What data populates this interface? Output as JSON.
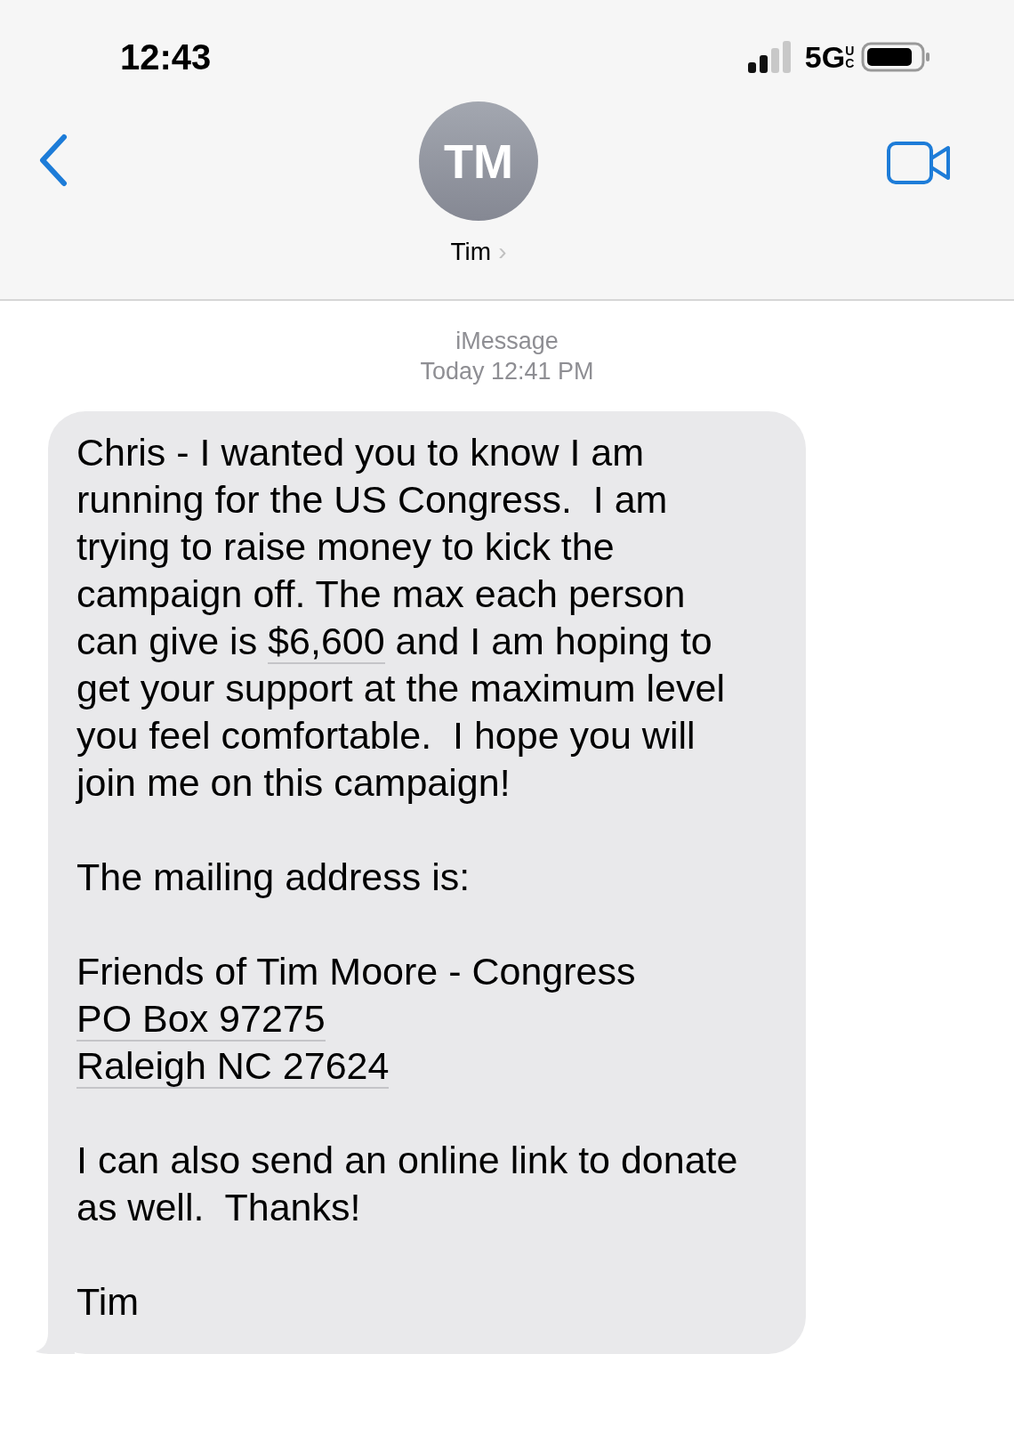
{
  "status_bar": {
    "time": "12:43",
    "network": "5G",
    "network_badge": "UC"
  },
  "header": {
    "avatar_initials": "TM",
    "contact_name": "Tim",
    "contact_chevron": "›"
  },
  "conversation": {
    "service": "iMessage",
    "timestamp": "Today 12:41 PM"
  },
  "message": {
    "paragraphs": [
      {
        "lines": [
          "Chris - I wanted you to know I am",
          "running for the US Congress.  I am",
          "trying to raise money to kick the",
          "campaign off. The max each person",
          [
            {
              "text": "can give is ",
              "link": false
            },
            {
              "text": "$6,600",
              "link": true
            },
            {
              "text": " and I am hoping to",
              "link": false
            }
          ],
          "get your support at the maximum level",
          "you feel comfortable.  I hope you will",
          "join me on this campaign!"
        ]
      },
      {
        "lines": [
          "The mailing address is:"
        ]
      },
      {
        "lines": [
          "Friends of Tim Moore - Congress",
          [
            {
              "text": "PO Box 97275",
              "link": true
            }
          ],
          [
            {
              "text": "Raleigh NC 27624",
              "link": true
            }
          ]
        ]
      },
      {
        "lines": [
          "I can also send an online link to donate",
          "as well.  Thanks!"
        ]
      },
      {
        "lines": [
          "Tim"
        ]
      }
    ]
  }
}
